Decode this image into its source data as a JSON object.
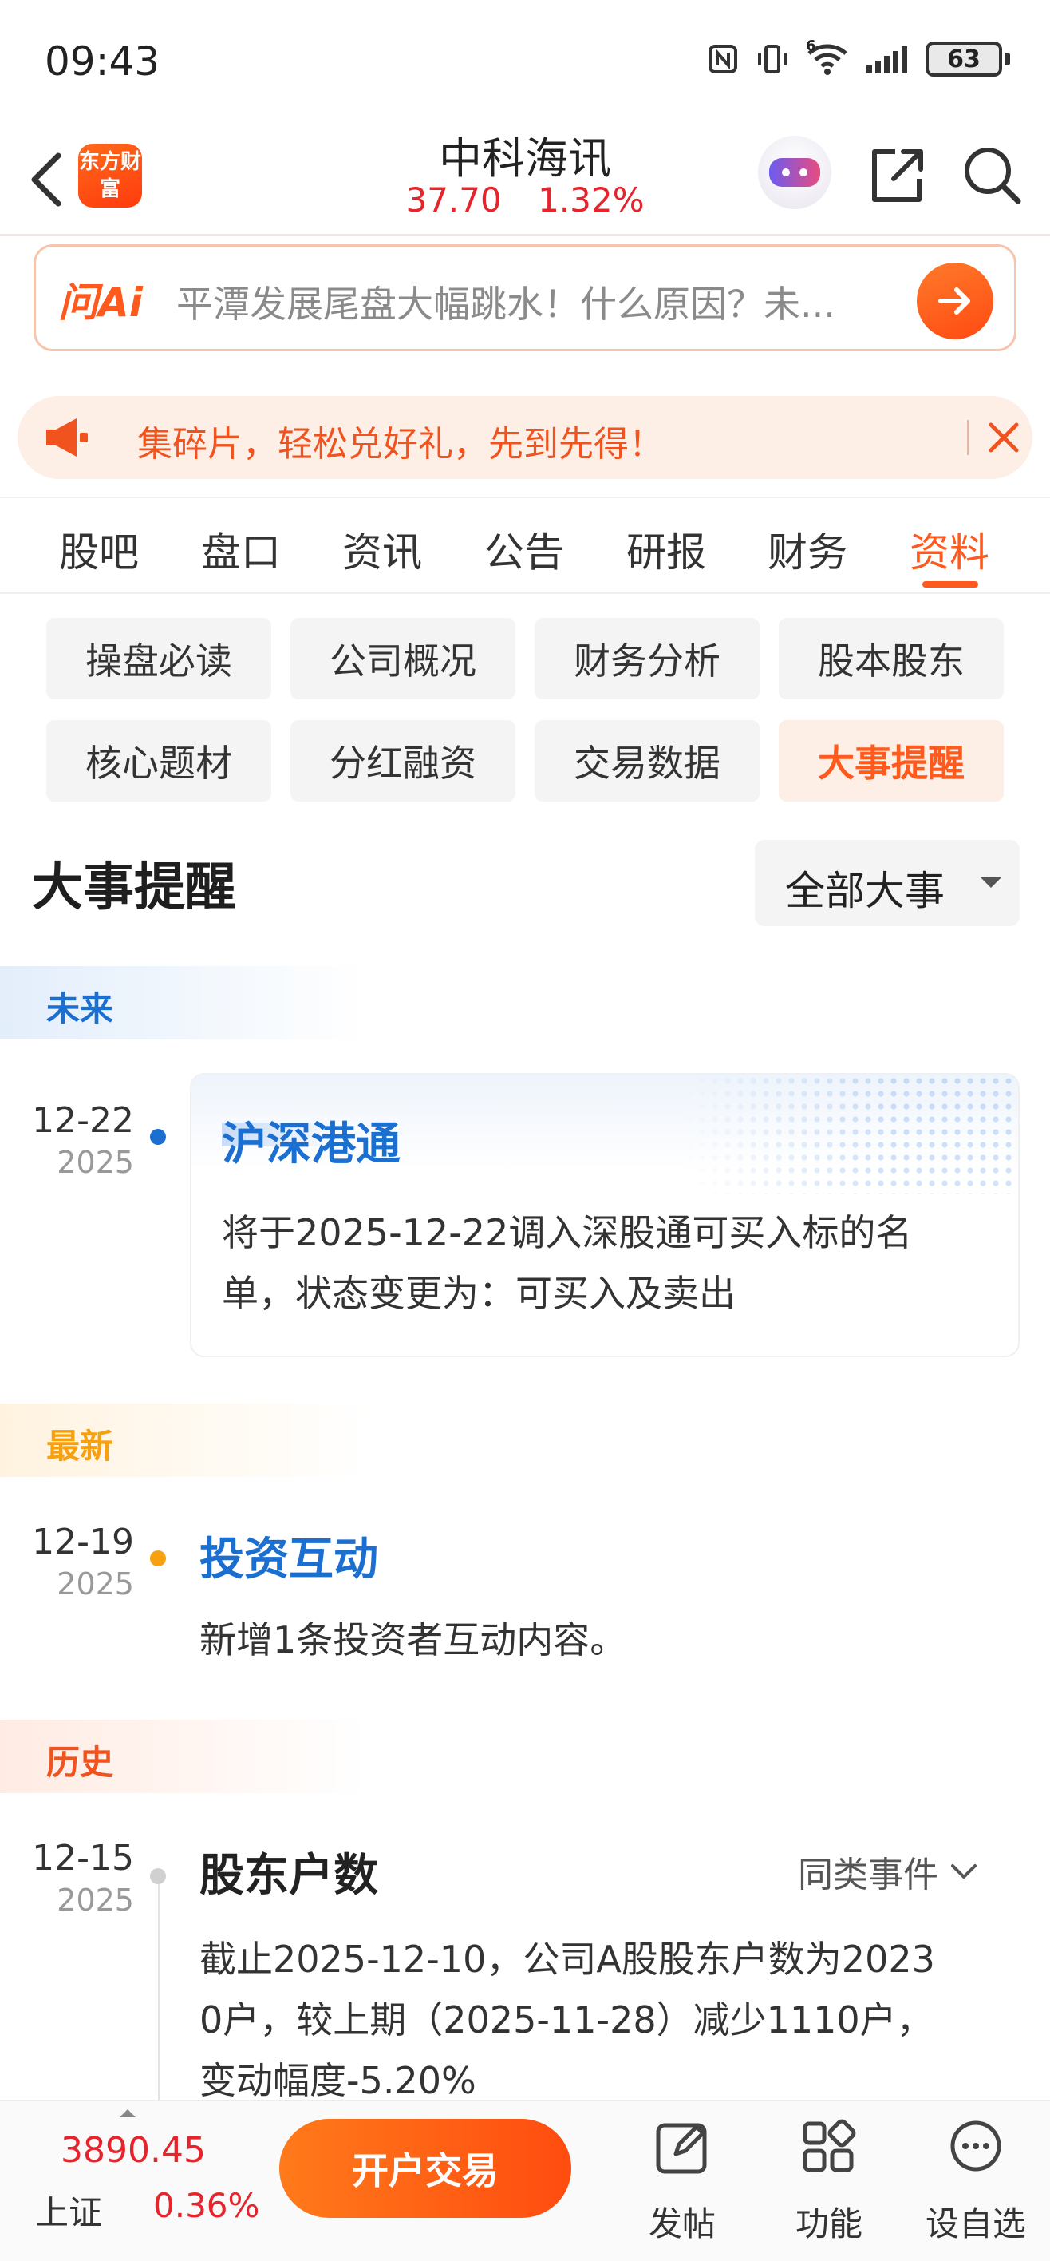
{
  "status_bar": {
    "time": "09:43",
    "battery": "63",
    "net_badge": "6"
  },
  "header": {
    "brand_logo_text": "东方财富",
    "stock_name": "中科海讯",
    "price": "37.70",
    "change_pct": "1.32%"
  },
  "ai_bar": {
    "label": "问Ai",
    "question": "平潭发展尾盘大幅跳水！什么原因？未..."
  },
  "promo": {
    "text": "集碎片，轻松兑好礼，先到先得！"
  },
  "tabs": [
    "股吧",
    "盘口",
    "资讯",
    "公告",
    "研报",
    "财务",
    "资料"
  ],
  "active_tab": "资料",
  "sub_tabs": [
    "操盘必读",
    "公司概况",
    "财务分析",
    "股本股东",
    "核心题材",
    "分红融资",
    "交易数据",
    "大事提醒"
  ],
  "active_sub_tab": "大事提醒",
  "section": {
    "title": "大事提醒",
    "filter": "全部大事"
  },
  "groups": {
    "future": "未来",
    "latest": "最新",
    "history": "历史"
  },
  "events": {
    "future": {
      "date": "12-22",
      "year": "2025",
      "title": "沪深港通",
      "body_line1": "将于2025-12-22调入深股通可买入标的名",
      "body_line2": "单，状态变更为：可买入及卖出"
    },
    "latest": {
      "date": "12-19",
      "year": "2025",
      "title": "投资互动",
      "body": "新增1条投资者互动内容。"
    },
    "history": {
      "date": "12-15",
      "year": "2025",
      "title": "股东户数",
      "similar": "同类事件",
      "body_line1": "截止2025-12-10，公司A股股东户数为2023",
      "body_line2": "0户，较上期（2025-11-28）减少1110户，",
      "body_line3": "变动幅度-5.20%"
    }
  },
  "bottom_bar": {
    "index_value": "3890.45",
    "index_name": "上证",
    "index_change": "0.36%",
    "trade_button": "开户交易",
    "nav": [
      "发帖",
      "功能",
      "设自选"
    ]
  },
  "colors": {
    "accent": "#ff5a1e",
    "rise": "#e5242b",
    "future_blue": "#1a6fd0",
    "latest_orange": "#f5a110",
    "history_red": "#f0531e"
  },
  "icons": [
    "back-arrow-icon",
    "share-icon",
    "search-icon",
    "megaphone-icon",
    "close-icon",
    "arrow-right-icon",
    "chevron-down-icon",
    "edit-icon",
    "grid-icon",
    "chat-bubble-icon"
  ]
}
